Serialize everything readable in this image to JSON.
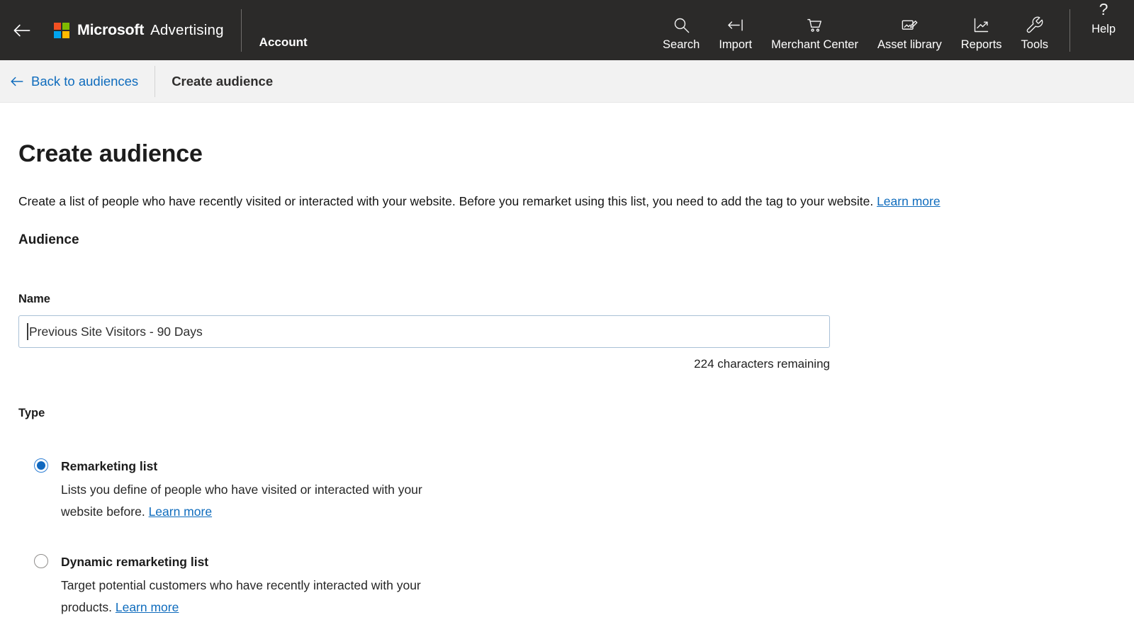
{
  "header": {
    "brand_name": "Microsoft",
    "brand_product": "Advertising",
    "account_label": "Account",
    "nav_items": [
      {
        "label": "Search",
        "icon": "search-icon"
      },
      {
        "label": "Import",
        "icon": "import-icon"
      },
      {
        "label": "Merchant Center",
        "icon": "merchant-center-cart-icon"
      },
      {
        "label": "Asset library",
        "icon": "asset-library-icon"
      },
      {
        "label": "Reports",
        "icon": "reports-chart-icon"
      },
      {
        "label": "Tools",
        "icon": "tools-wrench-icon"
      }
    ],
    "help_label": "Help",
    "help_glyph": "?"
  },
  "breadcrumb": {
    "back_label": "Back to audiences",
    "current_page": "Create audience"
  },
  "main": {
    "title": "Create audience",
    "intro_text": "Create a list of people who have recently visited or interacted with your website. Before you remarket using this list, you need to add the tag to your website.",
    "intro_link": "Learn more",
    "section_heading": "Audience",
    "name_field": {
      "label": "Name",
      "value": "Previous Site Visitors - 90 Days",
      "remaining_text": "224 characters remaining"
    },
    "type_field": {
      "label": "Type",
      "options": [
        {
          "label": "Remarketing list",
          "description": "Lists you define of people who have visited or interacted with your website before.",
          "link": "Learn more",
          "selected": true
        },
        {
          "label": "Dynamic remarketing list",
          "description": "Target potential customers who have recently interacted with your products.",
          "link": "Learn more",
          "selected": false
        }
      ]
    }
  },
  "colors": {
    "header_bg": "#2b2a29",
    "accent_blue": "#0f6cbd",
    "radio_selected": "#1068bf"
  }
}
